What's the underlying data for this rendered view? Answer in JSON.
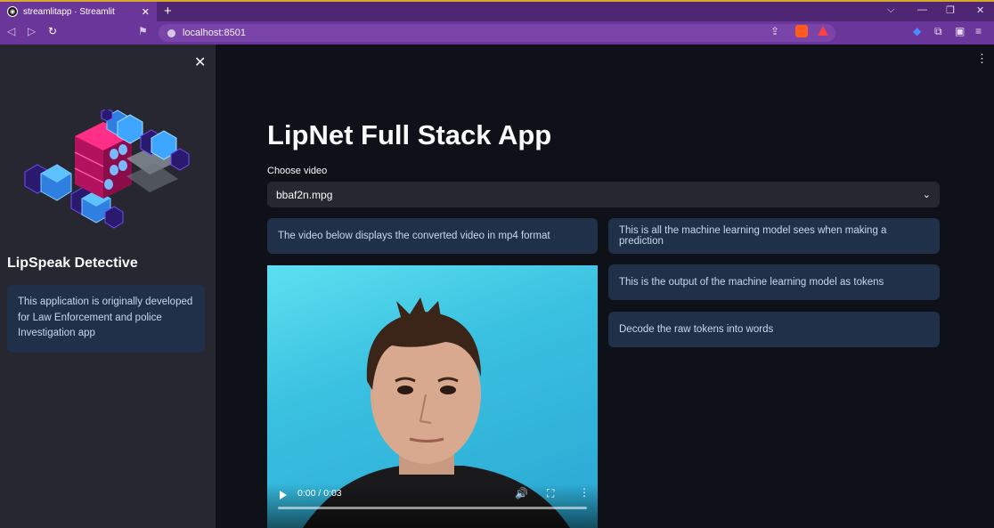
{
  "browser": {
    "tab_title": "streamlitapp · Streamlit",
    "url": "localhost:8501"
  },
  "sidebar": {
    "title": "LipSpeak Detective",
    "info": "This application is originally developed for Law Enforcement and police Investigation app"
  },
  "main": {
    "title": "LipNet Full Stack App",
    "select_label": "Choose video",
    "select_value": "bbaf2n.mpg",
    "left_info": "The video below displays the converted video in mp4 format",
    "right_info": [
      "This is all the machine learning model sees when making a prediction",
      "This is the output of the machine learning model as tokens",
      "Decode the raw tokens into words"
    ]
  },
  "video": {
    "time": "0:00 / 0:03",
    "progress": 0
  },
  "colors": {
    "app_bg": "#0e1117",
    "sidebar_bg": "#262730",
    "info_bg": "#1f3048",
    "browser_accent": "#6b3699"
  }
}
